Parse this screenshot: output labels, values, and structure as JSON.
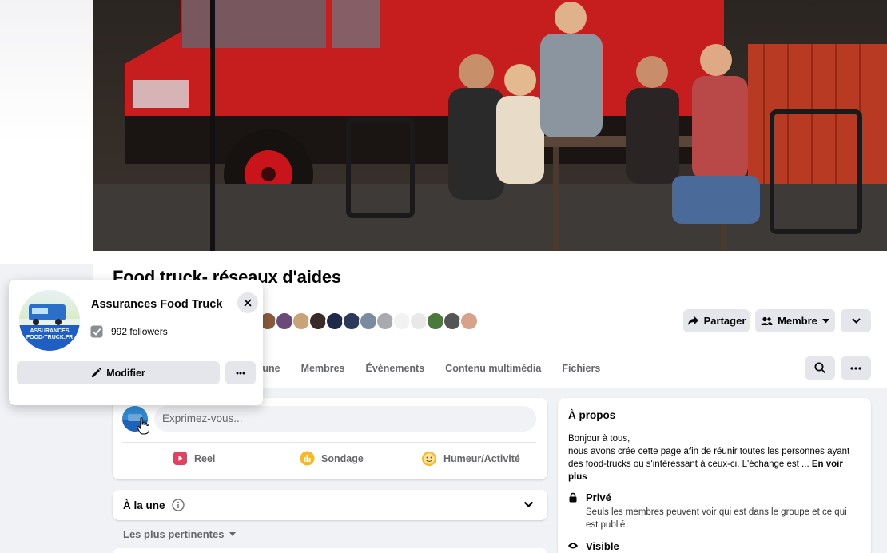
{
  "group": {
    "name": "Food truck- réseaux d'aides",
    "actions": {
      "share": "Partager",
      "member": "Membre"
    },
    "tabs": [
      "À la une",
      "Membres",
      "Évènements",
      "Contenu multimédia",
      "Fichiers"
    ]
  },
  "popup": {
    "page_name": "Assurances Food Truck",
    "followers": "992 followers",
    "edit": "Modifier",
    "logo_line1": "ASSURANCES",
    "logo_line2": "FOOD-TRUCK.FR"
  },
  "composer": {
    "placeholder": "Exprimez-vous...",
    "actions": {
      "reel": "Reel",
      "poll": "Sondage",
      "feeling": "Humeur/Activité"
    }
  },
  "feed": {
    "title": "À la une",
    "sort": "Les plus pertinentes"
  },
  "about": {
    "title": "À propos",
    "line1": "Bonjour à tous,",
    "line2": "nous avons crée cette page afin de réunir toutes les personnes ayant des food-trucks ou s'intéressant à ceux-ci. L'échange est ...",
    "see_more": "En voir plus",
    "private_title": "Privé",
    "private_desc": "Seuls les membres peuvent voir qui est dans le groupe et ce qui est publié.",
    "visible_title": "Visible"
  },
  "colors": {
    "accent": "#1877f2",
    "reel": "#e4405f",
    "poll": "#f7b928",
    "feeling": "#f7b928"
  },
  "member_avatar_colors": [
    "#8b5a3c",
    "#6b4a7a",
    "#c9a27a",
    "#3a2a2a",
    "#1f2a4a",
    "#2b3a5c",
    "#7a8aa0",
    "#a8aab0",
    "#f2f2f2",
    "#e8e8e8",
    "#4a7a3a",
    "#555555",
    "#d8a28a"
  ]
}
